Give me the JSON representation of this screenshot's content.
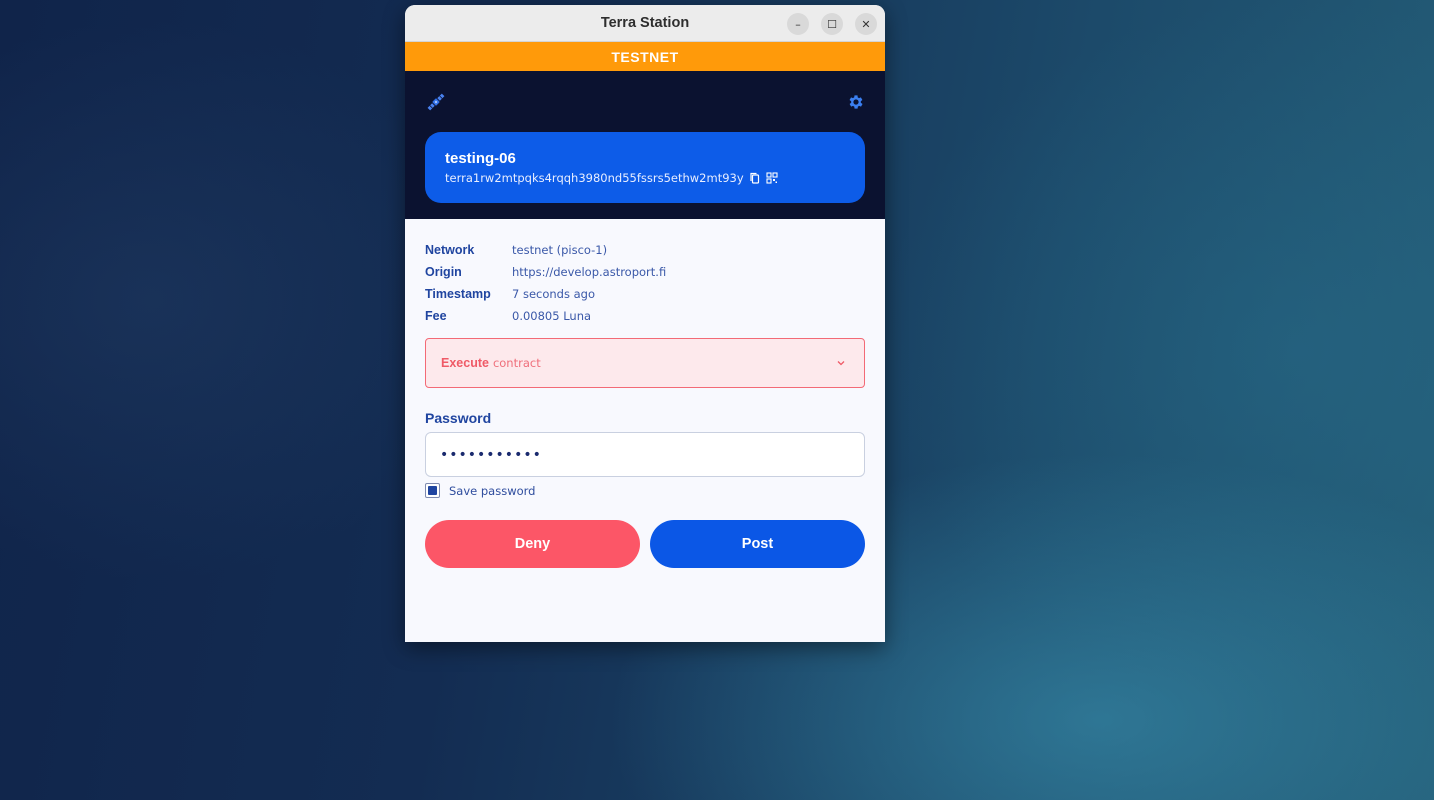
{
  "window": {
    "title": "Terra Station",
    "controls": {
      "minimize": "–",
      "maximize": "☐",
      "close": "✕"
    }
  },
  "banner": {
    "label": "TESTNET",
    "color": "#ff9a0a"
  },
  "header": {
    "left_icon": "satellite-icon",
    "right_icon": "gear-icon",
    "wallet": {
      "name": "testing-06",
      "address": "terra1rw2mtpqks4rqqh3980nd55fssrs5ethw2mt93y",
      "copy_icon": "copy-icon",
      "qr_icon": "qr-code-icon"
    }
  },
  "tx_info": {
    "rows": [
      {
        "label": "Network",
        "value": "testnet (pisco-1)"
      },
      {
        "label": "Origin",
        "value": "https://develop.astroport.fi"
      },
      {
        "label": "Timestamp",
        "value": "7 seconds ago"
      },
      {
        "label": "Fee",
        "value": "0.00805 Luna"
      }
    ]
  },
  "message": {
    "type": "Execute",
    "subtitle": "contract",
    "icon": "chevron-down-icon"
  },
  "password": {
    "label": "Password",
    "value": "•••••••••••",
    "save_label": "Save password",
    "save_checked": true
  },
  "actions": {
    "deny_label": "Deny",
    "post_label": "Post"
  },
  "colors": {
    "accent": "#0b57e6",
    "deny": "#fc5667",
    "header_bg": "#0b1230"
  }
}
